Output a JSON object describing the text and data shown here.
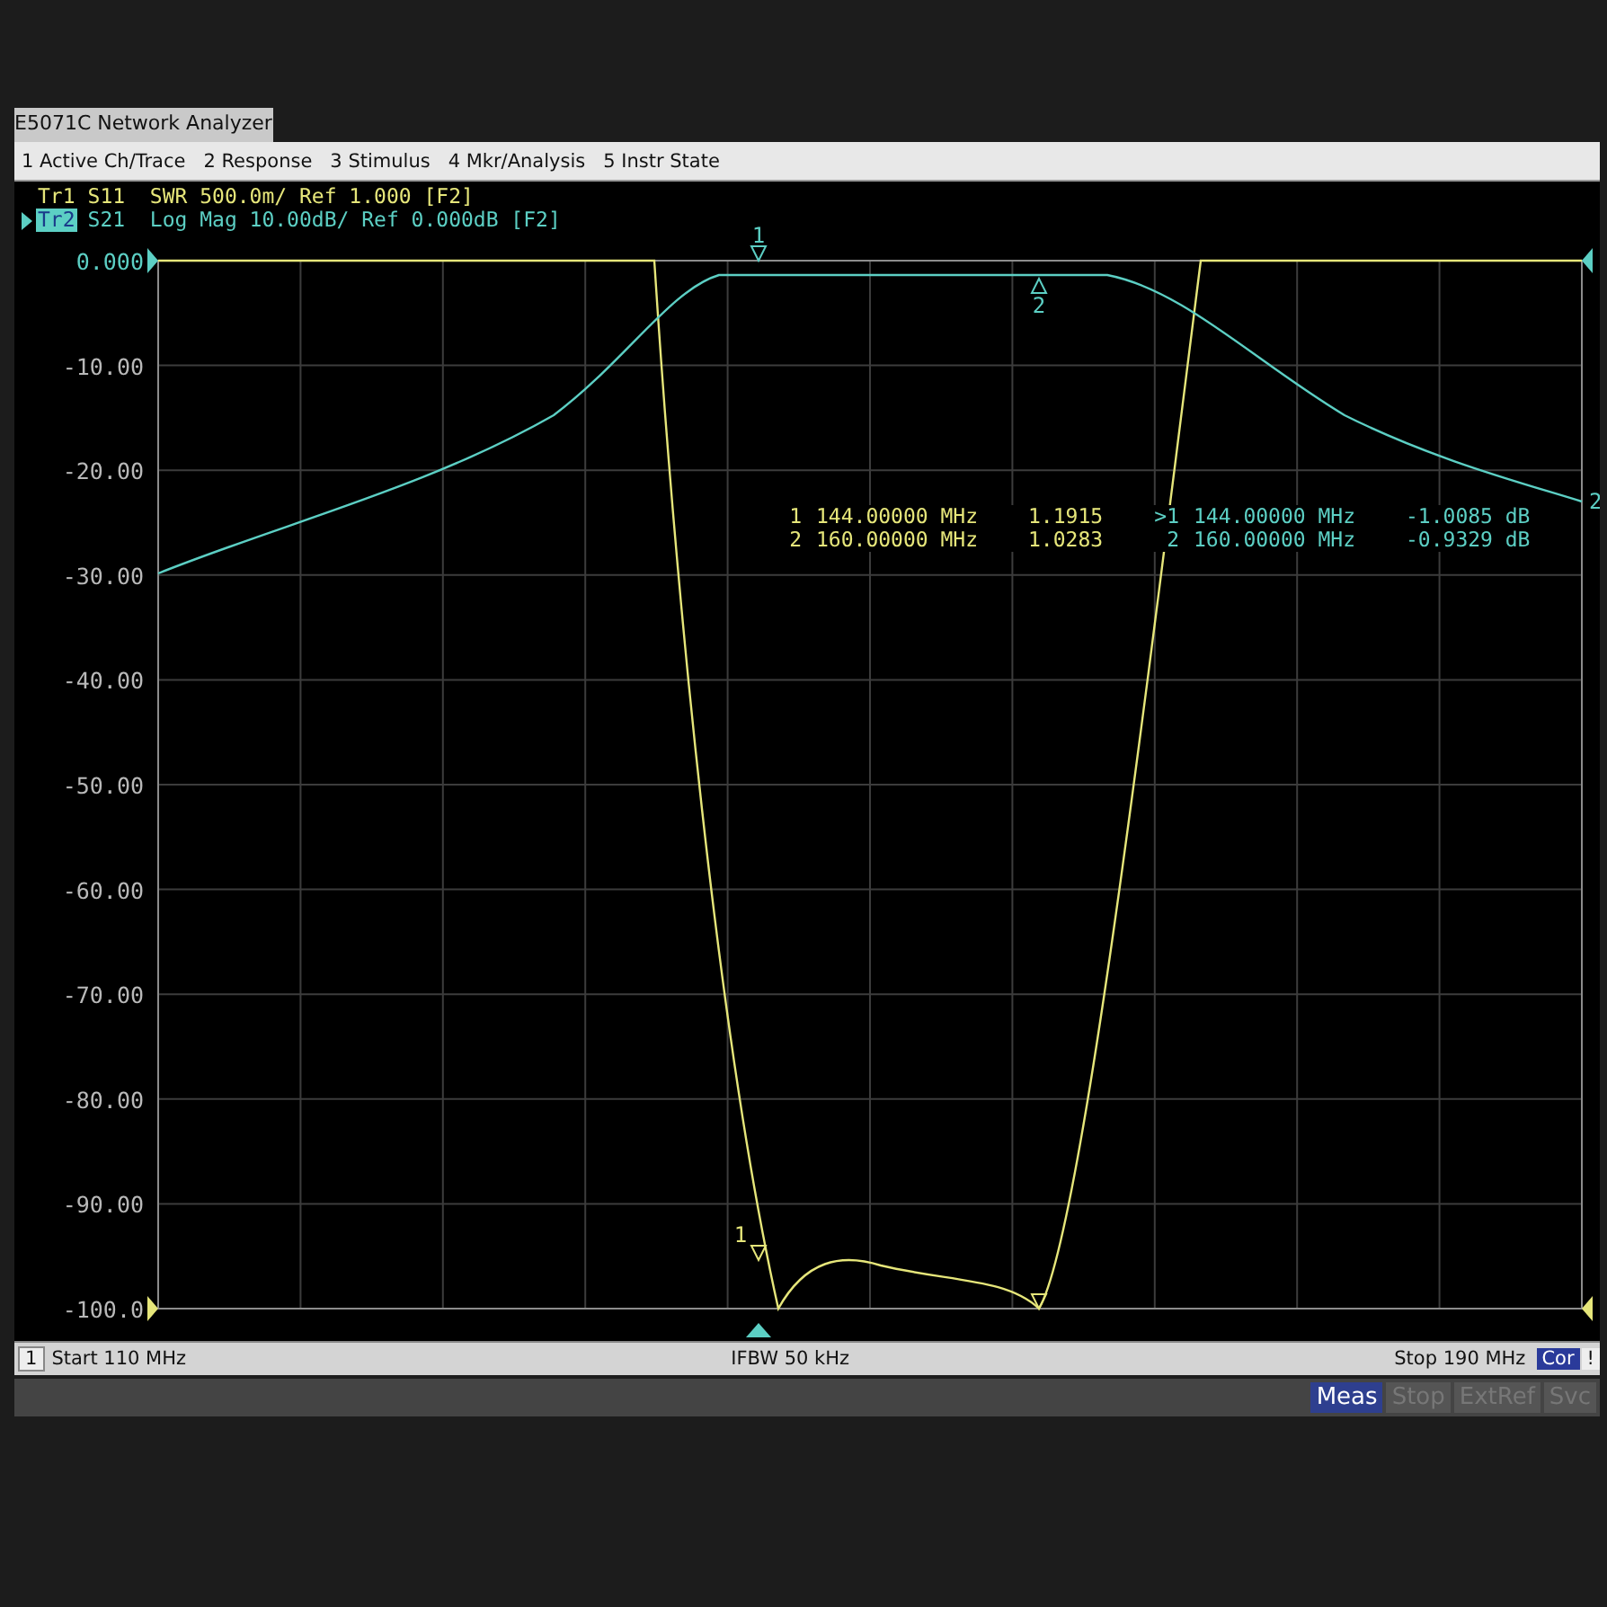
{
  "window": {
    "title": "E5071C Network Analyzer"
  },
  "menu": [
    "1 Active Ch/Trace",
    "2 Response",
    "3 Stimulus",
    "4 Mkr/Analysis",
    "5 Instr State"
  ],
  "traces": [
    {
      "label": "Tr1",
      "description": "S11  SWR 500.0m/ Ref 1.000 [F2]",
      "selected": false,
      "color": "#e6e67a",
      "marker_labels": [
        "1"
      ],
      "readouts": [
        {
          "marker": "1",
          "stimulus": "144.00000 MHz",
          "response": "1.1915"
        },
        {
          "marker": "2",
          "stimulus": "160.00000 MHz",
          "response": "1.0283"
        }
      ]
    },
    {
      "label": "Tr2",
      "description": "S21  Log Mag 10.00dB/ Ref 0.000dB [F2]",
      "selected": true,
      "color": "#5ccfc4",
      "marker_labels": [
        "1",
        "2"
      ],
      "end_label": "2",
      "readouts": [
        {
          "marker": ">1",
          "stimulus": "144.00000 MHz",
          "response": "-1.0085 dB"
        },
        {
          "marker": "2",
          "stimulus": "160.00000 MHz",
          "response": "-0.9329 dB"
        }
      ]
    }
  ],
  "y_axis_labels": [
    {
      "text": "0.000",
      "reference": true
    },
    {
      "text": "-10.00",
      "reference": false
    },
    {
      "text": "-20.00",
      "reference": false
    },
    {
      "text": "-30.00",
      "reference": false
    },
    {
      "text": "-40.00",
      "reference": false
    },
    {
      "text": "-50.00",
      "reference": false
    },
    {
      "text": "-60.00",
      "reference": false
    },
    {
      "text": "-70.00",
      "reference": false
    },
    {
      "text": "-80.00",
      "reference": false
    },
    {
      "text": "-90.00",
      "reference": false
    },
    {
      "text": "-100.0",
      "reference": false
    }
  ],
  "status_bar": {
    "channel": "1",
    "start": "Start 110 MHz",
    "ifbw": "IFBW 50 kHz",
    "stop": "Stop 190 MHz",
    "correction": "Cor",
    "warning": "!"
  },
  "soft_buttons": [
    {
      "label": "Meas",
      "selected": true
    },
    {
      "label": "Stop",
      "selected": false
    },
    {
      "label": "ExtRef",
      "selected": false
    },
    {
      "label": "Svc",
      "selected": false
    }
  ]
}
